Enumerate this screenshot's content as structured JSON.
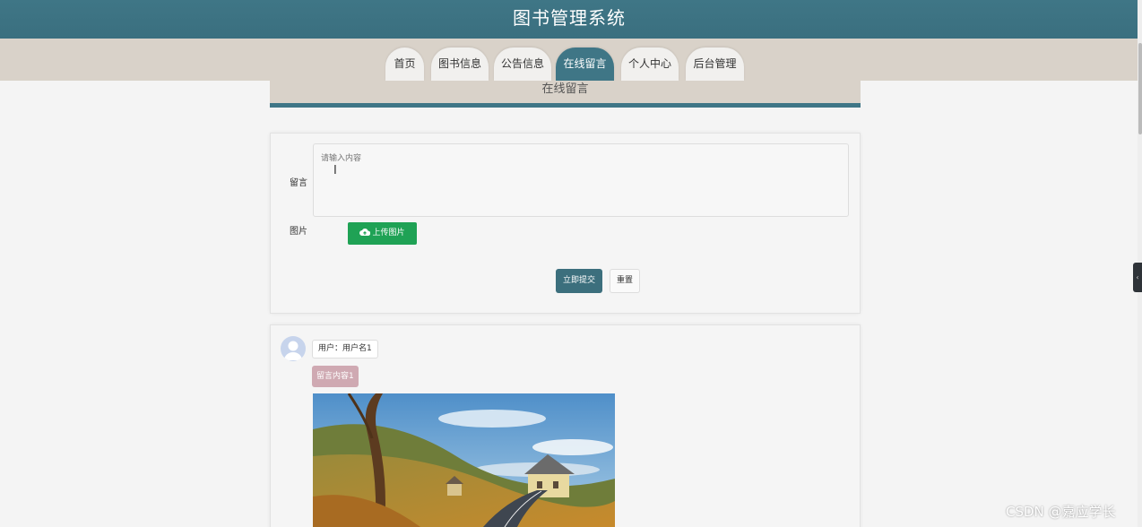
{
  "header": {
    "title": "图书管理系统"
  },
  "nav": {
    "tabs": [
      {
        "label": "首页"
      },
      {
        "label": "图书信息"
      },
      {
        "label": "公告信息"
      },
      {
        "label": "在线留言"
      },
      {
        "label": "个人中心"
      },
      {
        "label": "后台管理"
      }
    ],
    "active": "在线留言"
  },
  "section": {
    "title": "在线留言"
  },
  "form": {
    "message_label": "留言",
    "message_placeholder": "请输入内容",
    "image_label": "图片",
    "upload_label": "上传图片",
    "submit_label": "立即提交",
    "reset_label": "重置"
  },
  "comments": [
    {
      "user": "用户：用户名1",
      "content": "留言内容1"
    }
  ],
  "watermark": "CSDN @嘉应学长",
  "colors": {
    "primary": "#3f7686",
    "nav_band": "#d9d2c9",
    "upload": "#1fa255",
    "message_badge": "#cfa9b2"
  }
}
